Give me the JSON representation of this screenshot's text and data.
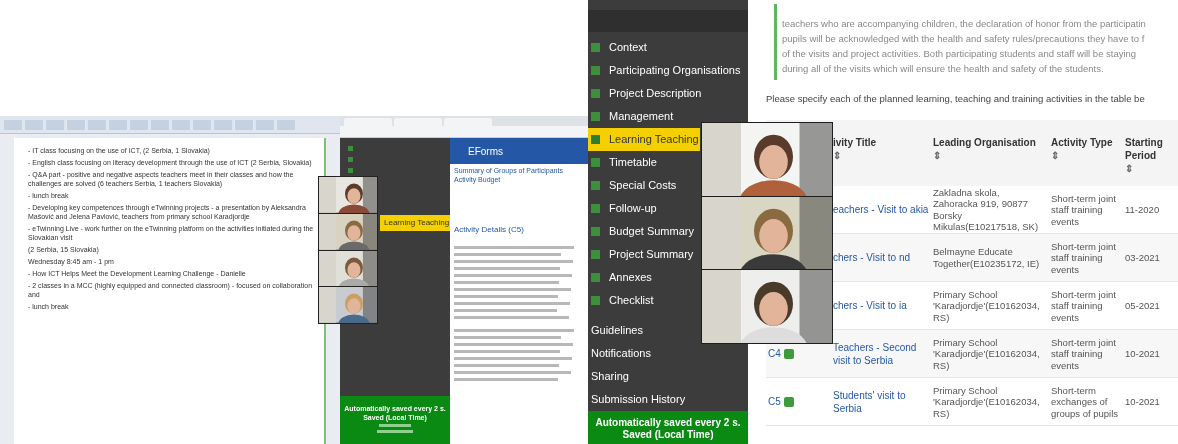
{
  "left_screen": {
    "document": {
      "lines": [
        "- IT class focusing on the use of ICT, (2 Serbia, 1 Slovakia)",
        "- English class focusing on literacy development through the use of ICT (2 Serbia, Slovakia)",
        "- Q&A part - positive and negative aspects teachers meet in their classes and how the challenges are solved (6 teachers Serbia, 1 teachers Slovakia)",
        "- lunch break",
        "- Developing key competences through eTwinning projects - a presentation by Aleksandra Mašović and Jelena Pavlović, teachers from primary school Karadjordje",
        "- eTwinning Live - work further on the eTwinning platform on the activities initiated during the Slovakian visit",
        "(2 Serbia, 15 Slovakia)",
        "Wednesday 8:45 am - 1 pm",
        "- How ICT Helps Meet the Development Learning Challenge - Danielle",
        "- 2 classes in a MCC (highly equipped and connected classroom) - focused on collaboration and",
        "- lunch break"
      ]
    },
    "browser": {
      "sidebar_items": [
        {
          "label": "Learning Teaching",
          "selected": true
        }
      ],
      "autosave": [
        "Automatically saved every 2 s.",
        "Saved (Local Time)"
      ],
      "eforms": {
        "title": "EForms",
        "links": [
          "Summary of Groups of Participants",
          "Activity Budget"
        ],
        "heading": "Activity Details (C5)"
      }
    }
  },
  "right_screen": {
    "intro_lines": [
      "teachers who are accompanying children, the declaration of honor from the participatin",
      "pupils will be acknowledged with the health and safety rules/precautions they have to f",
      "of the visits and project activities. Both participating students and staff will be staying",
      "during all of the visits which will ensure the health and safety of the students."
    ],
    "instruction": "Please specify each of the planned learning, teaching and training activities in the table be",
    "sidebar_items": [
      {
        "kind": "step",
        "label": "Context",
        "selected": false
      },
      {
        "kind": "step",
        "label": "Participating Organisations",
        "selected": false
      },
      {
        "kind": "step",
        "label": "Project Description",
        "selected": false
      },
      {
        "kind": "step",
        "label": "Management",
        "selected": false
      },
      {
        "kind": "step",
        "label": "Learning Teaching",
        "selected": true
      },
      {
        "kind": "step",
        "label": "Timetable",
        "selected": false
      },
      {
        "kind": "step",
        "label": "Special Costs",
        "selected": false
      },
      {
        "kind": "step",
        "label": "Follow-up",
        "selected": false
      },
      {
        "kind": "step",
        "label": "Budget Summary",
        "selected": false
      },
      {
        "kind": "step",
        "label": "Project Summary",
        "selected": false
      },
      {
        "kind": "step",
        "label": "Annexes",
        "selected": false
      },
      {
        "kind": "step",
        "label": "Checklist",
        "selected": false
      },
      {
        "kind": "section",
        "label": "Guidelines",
        "selected": false
      },
      {
        "kind": "section",
        "label": "Notifications",
        "selected": false
      },
      {
        "kind": "section",
        "label": "Sharing",
        "selected": false
      },
      {
        "kind": "section",
        "label": "Submission History",
        "selected": false
      }
    ],
    "autosave": [
      "Automatically saved every 2 s.",
      "Saved (Local Time)"
    ],
    "table": {
      "columns": [
        {
          "label": "ivity Title",
          "sort": "⇕"
        },
        {
          "label": "Leading Organisation",
          "sort": "⇕"
        },
        {
          "label": "Activity Type",
          "sort": "⇕"
        },
        {
          "label": "Starting Period",
          "sort": "⇕"
        }
      ],
      "rows": [
        {
          "title": "eachers - Visit to akia",
          "organisation": "Zakladna skola, Zahoracka 919, 90877 Borsky Mikulas(E10217518, SK)",
          "type": "Short-term joint staff training events",
          "period": "11-2020"
        },
        {
          "title": "chers - Visit to nd",
          "organisation": "Belmayne Educate Together(E10235172, IE)",
          "type": "Short-term joint staff training events",
          "period": "03-2021"
        },
        {
          "title": "chers - Visit to ia",
          "organisation": "Primary School 'Karadjordje'(E10162034, RS)",
          "type": "Short-term joint staff training events",
          "period": "05-2021"
        },
        {
          "code": "C4",
          "checked": true,
          "title": "Teachers - Second visit to Serbia",
          "organisation": "Primary School 'Karadjordje'(E10162034, RS)",
          "type": "Short-term joint staff training events",
          "period": "10-2021"
        },
        {
          "code": "C5",
          "checked": true,
          "title": "Students' visit to Serbia",
          "organisation": "Primary School 'Karadjordje'(E10162034, RS)",
          "type": "Short-term exchanges of groups of pupils",
          "period": "10-2021"
        }
      ]
    }
  }
}
